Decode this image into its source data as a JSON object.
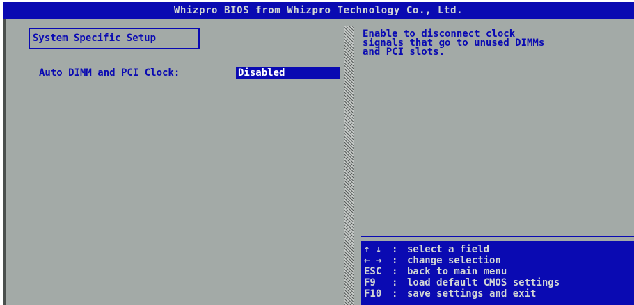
{
  "title_bar": "Whizpro BIOS from Whizpro Technology Co., Ltd.",
  "section_title": "System Specific Setup",
  "field": {
    "label": "Auto DIMM and PCI Clock:",
    "value": "Disabled"
  },
  "help_text": [
    "Enable to disconnect clock",
    "signals that go to unused DIMMs",
    "and PCI slots."
  ],
  "key_help": [
    {
      "key": "↑ ↓",
      "sep": ":",
      "desc": "select a field"
    },
    {
      "key": "← →",
      "sep": ":",
      "desc": "change selection"
    },
    {
      "key": "ESC",
      "sep": ":",
      "desc": "back to main menu"
    },
    {
      "key": "F9",
      "sep": ":",
      "desc": "load default CMOS settings"
    },
    {
      "key": "F10",
      "sep": ":",
      "desc": "save settings and exit"
    }
  ],
  "colors": {
    "background": "#a3aaa7",
    "accent": "#0a0ab2",
    "highlight_text": "#ffffff"
  }
}
